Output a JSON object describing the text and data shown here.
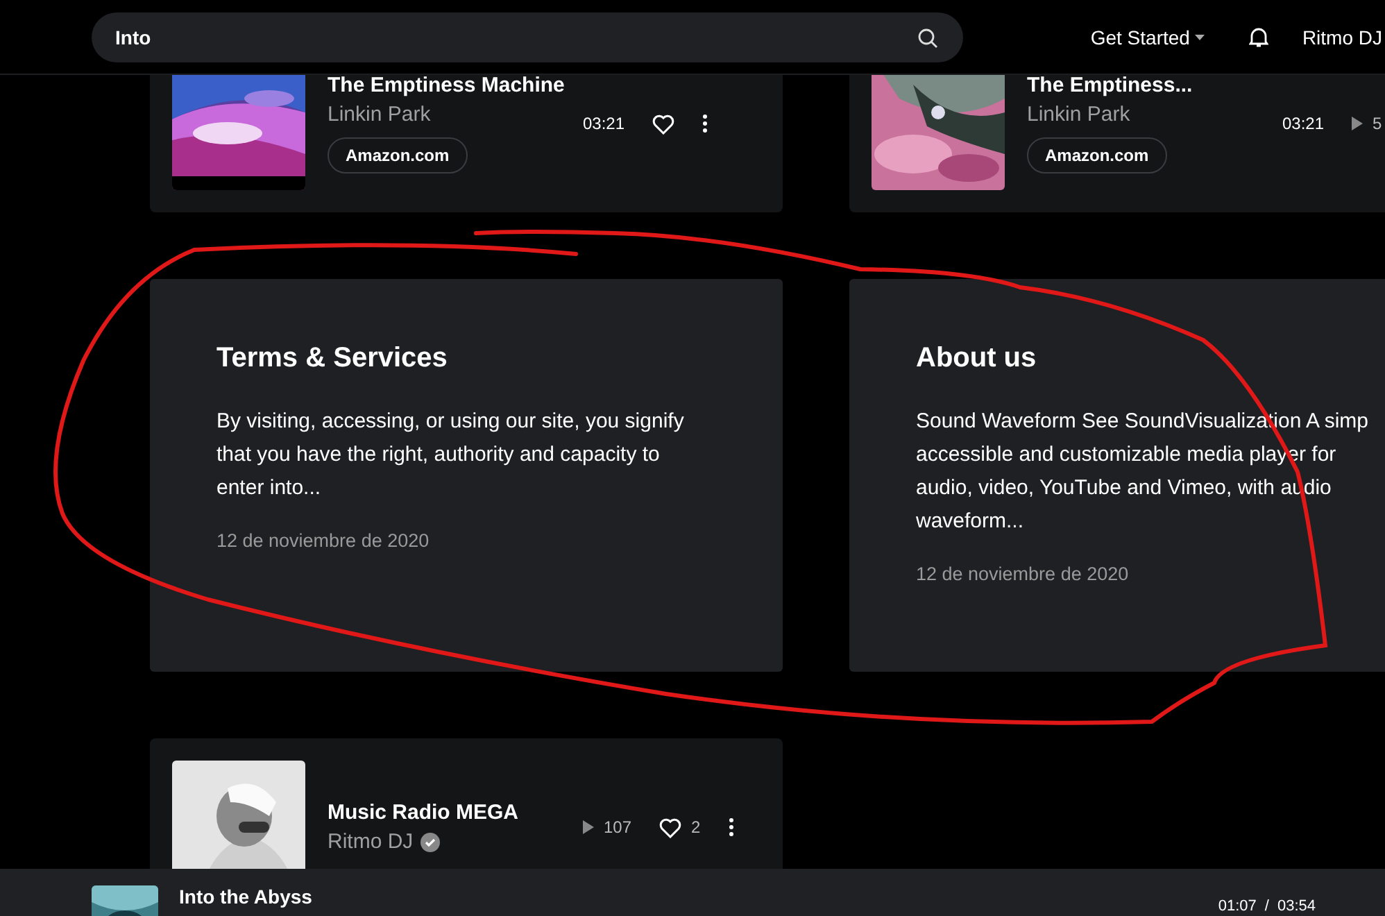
{
  "header": {
    "search": {
      "value": "Into"
    },
    "nav": [
      {
        "kind": "menu",
        "label": "Get Started"
      },
      {
        "kind": "bell"
      },
      {
        "kind": "user",
        "label": "Ritmo DJ"
      }
    ]
  },
  "rows": [
    {
      "kind": "tracks",
      "cards": [
        {
          "title": "The Emptiness Machine",
          "artist": "Linkin Park",
          "verified": false,
          "store": "Amazon.com",
          "meta": [
            {
              "kind": "duration",
              "text": "03:21"
            },
            {
              "kind": "like"
            },
            {
              "kind": "more"
            }
          ]
        },
        {
          "title": "The Emptiness...",
          "artist": "Linkin Park",
          "verified": false,
          "store": "Amazon.com",
          "meta": [
            {
              "kind": "duration",
              "text": "03:21"
            },
            {
              "kind": "plays",
              "text": "5"
            }
          ]
        }
      ]
    },
    {
      "kind": "posts",
      "cards": [
        {
          "title": "Terms & Services",
          "lines": [
            "By visiting, accessing, or using our site, you signify",
            "that you have the right, authority and capacity to",
            "enter into..."
          ],
          "date": "12 de noviembre de 2020"
        },
        {
          "title": "About us",
          "lines": [
            "Sound Waveform See SoundVisualization A simp",
            "accessible and customizable media player for",
            "audio, video, YouTube and Vimeo, with audio",
            "waveform..."
          ],
          "date": "12 de noviembre de 2020"
        }
      ]
    },
    {
      "kind": "tracks",
      "cards": [
        {
          "title": "Music Radio MEGA",
          "artist": "Ritmo DJ",
          "verified": true,
          "meta": [
            {
              "kind": "plays",
              "text": "107"
            },
            {
              "kind": "likes",
              "text": "2"
            },
            {
              "kind": "more"
            }
          ]
        }
      ]
    }
  ],
  "player": {
    "title": "Into the Abyss",
    "elapsed": "01:07",
    "separator": "/",
    "total": "03:54"
  }
}
